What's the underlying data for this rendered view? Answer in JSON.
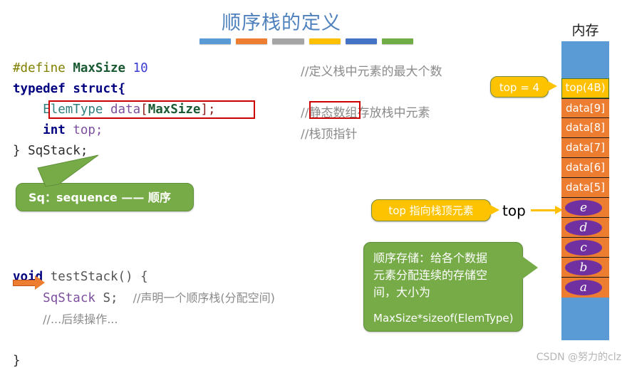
{
  "title": "顺序栈的定义",
  "accent_colors": {
    "title_blue": "#4f81bd",
    "dash1": "#5b9bd5",
    "dash2": "#ed7d31",
    "dash3": "#a5a5a5",
    "dash4": "#ffc000",
    "dash5": "#4472c4",
    "dash6": "#70ad47",
    "callout_green": "#76ab48",
    "callout_yellow": "#fdc300",
    "memory_blue": "#5b9bd5",
    "memory_yellow": "#ffc000",
    "memory_orange": "#ed7d31",
    "element_purple": "#7030a0",
    "highlight_red": "#cc0000"
  },
  "code_struct": {
    "line1": {
      "define": "#define",
      "name": "MaxSize",
      "value": "10"
    },
    "line2": {
      "typedef": "typedef",
      "struct": "struct{"
    },
    "line3": {
      "type": "ElemType",
      "var": "data",
      "lb": "[",
      "size": "MaxSize",
      "rb": "];"
    },
    "line4": {
      "type": "int",
      "var": "top;"
    },
    "line5": {
      "text": "} SqStack;"
    }
  },
  "code_test": {
    "line1": {
      "kw": "void",
      "fn": "testStack() {"
    },
    "line2": {
      "type": "SqStack",
      "var": "S;",
      "comment": "//声明一个顺序栈(分配空间)"
    },
    "line3": {
      "comment": "//...后续操作..."
    },
    "line4": {
      "text": "}"
    }
  },
  "comments": {
    "c1": "//定义栈中元素的最大个数",
    "c2_prefix": "//",
    "c2_boxed": "静态数组",
    "c2_suffix": "存放栈中元素",
    "c3": "//栈顶指针"
  },
  "callouts": {
    "sq_meaning": "Sq：sequence —— 顺序",
    "top_value": "top = 4",
    "top_points": "top 指向栈顶元素",
    "storage_line1": "顺序存储：给各个数据",
    "storage_line2": "元素分配连续的存储空",
    "storage_line3": "间，大小为",
    "storage_line4": "MaxSize*sizeof(ElemType)"
  },
  "labels": {
    "top_pointer": "top"
  },
  "memory": {
    "header": "内存",
    "top_cell": "top(4B)",
    "cells": [
      {
        "label": "data[9]",
        "value": ""
      },
      {
        "label": "data[8]",
        "value": ""
      },
      {
        "label": "data[7]",
        "value": ""
      },
      {
        "label": "data[6]",
        "value": ""
      },
      {
        "label": "data[5]",
        "value": ""
      },
      {
        "label": "",
        "value": "e"
      },
      {
        "label": "",
        "value": "d"
      },
      {
        "label": "",
        "value": "c"
      },
      {
        "label": "",
        "value": "b"
      },
      {
        "label": "",
        "value": "a"
      }
    ]
  },
  "watermark": "CSDN @努力的clz"
}
